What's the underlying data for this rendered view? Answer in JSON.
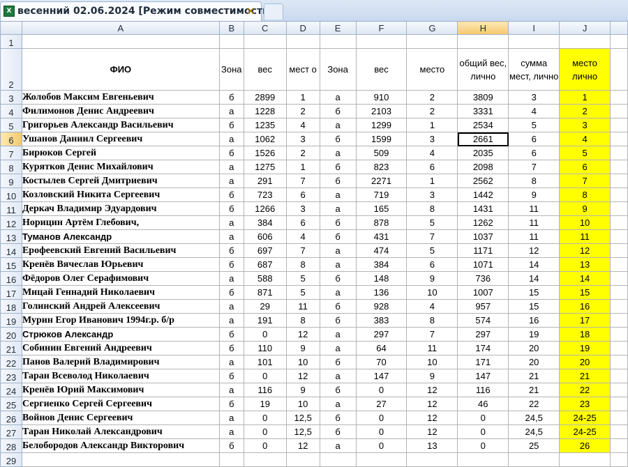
{
  "window": {
    "tab_title": "весенний 02.06.2024  [Режим совместимости]",
    "close_symbol": "✕",
    "app_icon": "excel-icon"
  },
  "columns": [
    "A",
    "B",
    "C",
    "D",
    "E",
    "F",
    "G",
    "H",
    "I",
    "J"
  ],
  "header_row": {
    "fio": "ФИО",
    "zona1": "Зона",
    "ves1": "вес",
    "mesto1": "мест о",
    "zona2": "Зона",
    "ves2": "вес",
    "mesto2": "место",
    "total_weight": "общий вес, лично",
    "sum_places": "сумма мест, лично",
    "place_personal": "место лично"
  },
  "active_cell": "H6",
  "highlight_color": "#ffff00",
  "rows": [
    {
      "n": "3",
      "name": " Жолобов Максим Евгеньевич",
      "z1": "б",
      "w1": "2899",
      "m1": "1",
      "z2": "а",
      "w2": "910",
      "m2": "2",
      "tw": "3809",
      "sp": "3",
      "pl": "1"
    },
    {
      "n": "4",
      "name": "Филимонов Денис Андреевич",
      "z1": "а",
      "w1": "1228",
      "m1": "2",
      "z2": "б",
      "w2": "2103",
      "m2": "2",
      "tw": "3331",
      "sp": "4",
      "pl": "2"
    },
    {
      "n": "5",
      "name": " Григорьев Александр Васильевич",
      "z1": "б",
      "w1": "1235",
      "m1": "4",
      "z2": "а",
      "w2": "1299",
      "m2": "1",
      "tw": "2534",
      "sp": "5",
      "pl": "3"
    },
    {
      "n": "6",
      "name": "Ушанов Даниил Сергеевич",
      "z1": "а",
      "w1": "1062",
      "m1": "3",
      "z2": "б",
      "w2": "1599",
      "m2": "3",
      "tw": "2661",
      "sp": "6",
      "pl": "4"
    },
    {
      "n": "7",
      "name": "Бирюков Сергей",
      "z1": "б",
      "w1": "1526",
      "m1": "2",
      "z2": "а",
      "w2": "509",
      "m2": "4",
      "tw": "2035",
      "sp": "6",
      "pl": "5"
    },
    {
      "n": "8",
      "name": " Курятков Денис Михайлович",
      "z1": "а",
      "w1": "1275",
      "m1": "1",
      "z2": "б",
      "w2": "823",
      "m2": "6",
      "tw": "2098",
      "sp": "7",
      "pl": "6"
    },
    {
      "n": "9",
      "name": " Костылев Сергей Дмитриевич",
      "z1": "а",
      "w1": "291",
      "m1": "7",
      "z2": "б",
      "w2": "2271",
      "m2": "1",
      "tw": "2562",
      "sp": "8",
      "pl": "7"
    },
    {
      "n": "10",
      "name": "Козловский Никита Сергеевич",
      "z1": "б",
      "w1": "723",
      "m1": "6",
      "z2": "а",
      "w2": "719",
      "m2": "3",
      "tw": "1442",
      "sp": "9",
      "pl": "8"
    },
    {
      "n": "11",
      "name": "Деркач Владимир Эдуардович",
      "z1": "б",
      "w1": "1266",
      "m1": "3",
      "z2": "а",
      "w2": "165",
      "m2": "8",
      "tw": "1431",
      "sp": "11",
      "pl": "9"
    },
    {
      "n": "12",
      "name": "Норицин Артём Глебович,",
      "z1": "а",
      "w1": "384",
      "m1": "6",
      "z2": "б",
      "w2": "878",
      "m2": "5",
      "tw": "1262",
      "sp": "11",
      "pl": "10"
    },
    {
      "n": "13",
      "name": "Туманов Александр",
      "z1": "а",
      "w1": "606",
      "m1": "4",
      "z2": "б",
      "w2": "431",
      "m2": "7",
      "tw": "1037",
      "sp": "11",
      "pl": "11",
      "sans": true
    },
    {
      "n": "14",
      "name": "Ерофеевский Евгений Васильевич",
      "z1": "б",
      "w1": "697",
      "m1": "7",
      "z2": "а",
      "w2": "474",
      "m2": "5",
      "tw": "1171",
      "sp": "12",
      "pl": "12"
    },
    {
      "n": "15",
      "name": "Кренёв Вячеслав Юрьевич",
      "z1": "б",
      "w1": "687",
      "m1": "8",
      "z2": "а",
      "w2": "384",
      "m2": "6",
      "tw": "1071",
      "sp": "14",
      "pl": "13"
    },
    {
      "n": "16",
      "name": "Фёдоров Олег Серафимович",
      "z1": "а",
      "w1": "588",
      "m1": "5",
      "z2": "б",
      "w2": "148",
      "m2": "9",
      "tw": "736",
      "sp": "14",
      "pl": "14"
    },
    {
      "n": "17",
      "name": "Мицай Геннадий Николаевич",
      "z1": "б",
      "w1": "871",
      "m1": "5",
      "z2": "а",
      "w2": "136",
      "m2": "10",
      "tw": "1007",
      "sp": "15",
      "pl": "15"
    },
    {
      "n": "18",
      "name": "Голинский Андрей Алексеевич",
      "z1": "а",
      "w1": "29",
      "m1": "11",
      "z2": "б",
      "w2": "928",
      "m2": "4",
      "tw": "957",
      "sp": "15",
      "pl": "16"
    },
    {
      "n": "19",
      "name": "Мурин Егор Иванович 1994г.р. б/р",
      "z1": "а",
      "w1": "191",
      "m1": "8",
      "z2": "б",
      "w2": "383",
      "m2": "8",
      "tw": "574",
      "sp": "16",
      "pl": "17"
    },
    {
      "n": "20",
      "name": "Стрюков Александр",
      "z1": "б",
      "w1": "0",
      "m1": "12",
      "z2": "а",
      "w2": "297",
      "m2": "7",
      "tw": "297",
      "sp": "19",
      "pl": "18",
      "sans": true
    },
    {
      "n": "21",
      "name": "Собинин Евгений Андреевич",
      "z1": "б",
      "w1": "110",
      "m1": "9",
      "z2": "а",
      "w2": "64",
      "m2": "11",
      "tw": "174",
      "sp": "20",
      "pl": "19"
    },
    {
      "n": "22",
      "name": " Панов Валерий Владимирович",
      "z1": "а",
      "w1": "101",
      "m1": "10",
      "z2": "б",
      "w2": "70",
      "m2": "10",
      "tw": "171",
      "sp": "20",
      "pl": "20"
    },
    {
      "n": "23",
      "name": "Таран Всеволод Николаевич",
      "z1": "б",
      "w1": "0",
      "m1": "12",
      "z2": "а",
      "w2": "147",
      "m2": "9",
      "tw": "147",
      "sp": "21",
      "pl": "21"
    },
    {
      "n": "24",
      "name": "Кренёв Юрий Максимович",
      "z1": "а",
      "w1": "116",
      "m1": "9",
      "z2": "б",
      "w2": "0",
      "m2": "12",
      "tw": "116",
      "sp": "21",
      "pl": "22"
    },
    {
      "n": "25",
      "name": "Сергиенко Сергей Сергеевич",
      "z1": "б",
      "w1": "19",
      "m1": "10",
      "z2": "а",
      "w2": "27",
      "m2": "12",
      "tw": "46",
      "sp": "22",
      "pl": "23"
    },
    {
      "n": "26",
      "name": "Войнов Денис Сергеевич",
      "z1": "а",
      "w1": "0",
      "m1": "12,5",
      "z2": "б",
      "w2": "0",
      "m2": "12",
      "tw": "0",
      "sp": "24,5",
      "pl": "24-25"
    },
    {
      "n": "27",
      "name": "Таран Николай Александрович",
      "z1": "а",
      "w1": "0",
      "m1": "12,5",
      "z2": "б",
      "w2": "0",
      "m2": "12",
      "tw": "0",
      "sp": "24,5",
      "pl": "24-25"
    },
    {
      "n": "28",
      "name": "Белобородов Александр Викторович",
      "z1": "б",
      "w1": "0",
      "m1": "12",
      "z2": "а",
      "w2": "0",
      "m2": "13",
      "tw": "0",
      "sp": "25",
      "pl": "26"
    }
  ],
  "empty_row_label": "29",
  "row_labels": {
    "r1": "1",
    "r2": "2"
  }
}
